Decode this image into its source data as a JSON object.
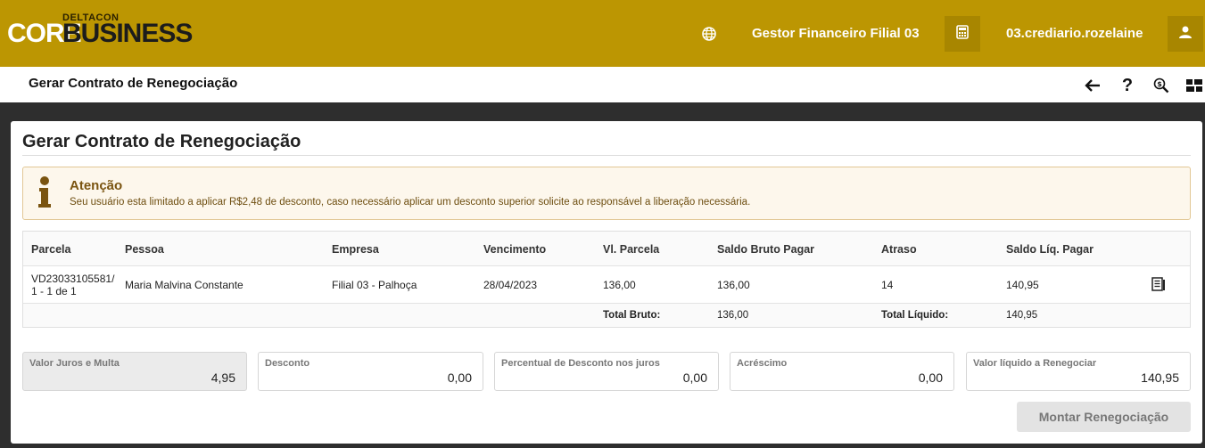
{
  "header": {
    "logo_prefix": "DELTACON",
    "logo_core": "CORE",
    "logo_business": "BUSINESS",
    "company": "Gestor Financeiro Filial 03",
    "user": "03.crediario.rozelaine"
  },
  "toolbar": {
    "title": "Gerar Contrato de Renegociação",
    "icons": [
      "back-arrow-icon",
      "help-icon",
      "money-search-icon",
      "dashboard-icon"
    ]
  },
  "page": {
    "title": "Gerar Contrato de Renegociação"
  },
  "alert": {
    "title": "Atenção",
    "text": "Seu usuário esta limitado a aplicar R$2,48 de desconto, caso necessário aplicar um desconto superior solicite ao responsável a liberação necessária."
  },
  "table": {
    "headers": [
      "Parcela",
      "Pessoa",
      "Empresa",
      "Vencimento",
      "Vl. Parcela",
      "Saldo Bruto Pagar",
      "Atraso",
      "Saldo Líq. Pagar"
    ],
    "rows": [
      {
        "parcela_line1": "VD23033105581/",
        "parcela_line2": "1 - 1 de 1",
        "pessoa": "Maria Malvina Constante",
        "empresa": "Filial 03 - Palhoça",
        "vencimento": "28/04/2023",
        "vl_parcela": "136,00",
        "saldo_bruto": "136,00",
        "atraso": "14",
        "saldo_liquido": "140,95"
      }
    ],
    "footer": {
      "total_bruto_label": "Total Bruto:",
      "total_bruto_value": "136,00",
      "total_liquido_label": "Total Líquido:",
      "total_liquido_value": "140,95"
    }
  },
  "fields": [
    {
      "label": "Valor Juros e Multa",
      "value": "4,95",
      "readonly": true
    },
    {
      "label": "Desconto",
      "value": "0,00",
      "readonly": false
    },
    {
      "label": "Percentual de Desconto nos juros",
      "value": "0,00",
      "readonly": false
    },
    {
      "label": "Acréscimo",
      "value": "0,00",
      "readonly": false
    },
    {
      "label": "Valor líquido a Renegociar",
      "value": "140,95",
      "readonly": false
    }
  ],
  "actions": {
    "montar_label": "Montar Renegociação"
  },
  "colors": {
    "header_bg": "#bc9602",
    "alert_bg": "#fdf7ec",
    "alert_text": "#7a5410"
  }
}
